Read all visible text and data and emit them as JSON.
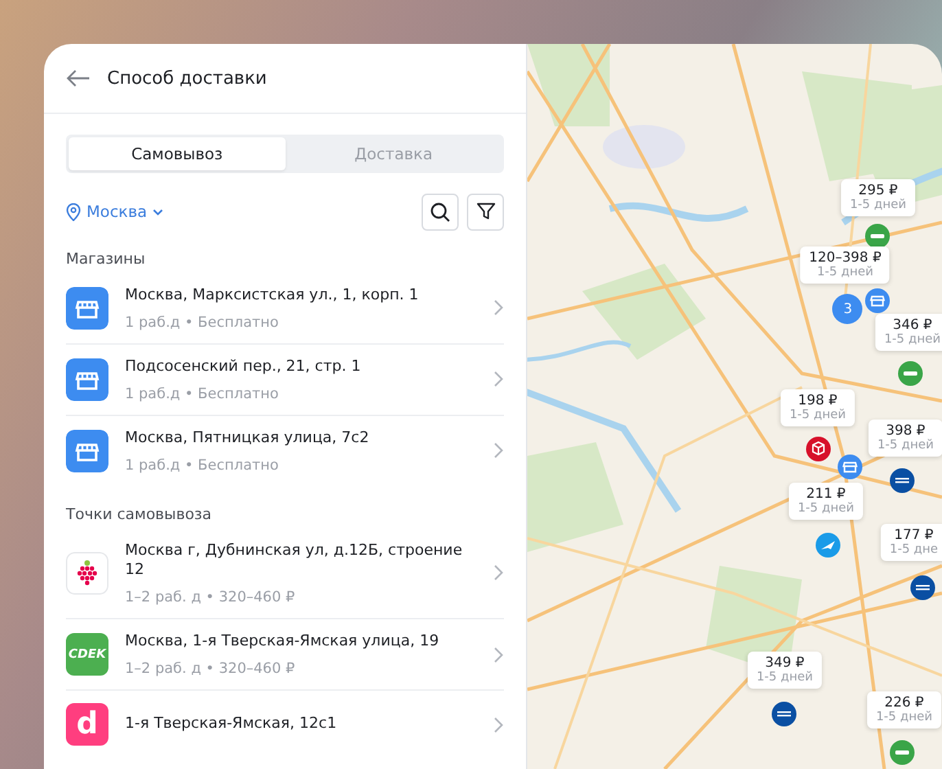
{
  "header": {
    "title": "Способ доставки"
  },
  "tabs": [
    {
      "label": "Самовывоз",
      "selected": true
    },
    {
      "label": "Доставка",
      "selected": false
    }
  ],
  "city": "Москва",
  "sections": [
    {
      "title": "Магазины",
      "items": [
        {
          "kind": "store",
          "address": "Москва, Марксистская ул., 1, корп. 1",
          "details": "1 раб.д • Бесплатно"
        },
        {
          "kind": "store",
          "address": "Подсосенский пер., 21, стр. 1",
          "details": "1 раб.д • Бесплатно"
        },
        {
          "kind": "store",
          "address": "Москва, Пятницкая улица, 7с2",
          "details": "1 раб.д • Бесплатно"
        }
      ]
    },
    {
      "title": "Точки самовывоза",
      "items": [
        {
          "kind": "berry",
          "address": "Москва г, Дубнинская ул, д.12Б, строение 12",
          "details": "1–2 раб. д • 320–460 ₽"
        },
        {
          "kind": "cdek",
          "logo_text": "CDEK",
          "address": "Москва, 1-я Тверская-Ямская улица, 19",
          "details": "1–2 раб. д • 320–460 ₽"
        },
        {
          "kind": "pink",
          "logo_text": "d",
          "address": "1-я Тверская-Ямская, 12с1"
        }
      ]
    }
  ],
  "map": {
    "price_pins": [
      {
        "price": "295 ₽",
        "days": "1-5 дней"
      },
      {
        "price": "120–398 ₽",
        "days": "1-5 дней"
      },
      {
        "price": "346 ₽",
        "days": "1-5 дней"
      },
      {
        "price": "198 ₽",
        "days": "1-5 дней"
      },
      {
        "price": "398 ₽",
        "days": "1-5 дней"
      },
      {
        "price": "211 ₽",
        "days": "1-5 дней"
      },
      {
        "price": "177 ₽",
        "days": "1-5 дне"
      },
      {
        "price": "349 ₽",
        "days": "1-5 дней"
      },
      {
        "price": "226 ₽",
        "days": "1-5 дней"
      }
    ],
    "cluster": "3",
    "markers": [
      {
        "kind": "green"
      },
      {
        "kind": "store"
      },
      {
        "kind": "green"
      },
      {
        "kind": "box"
      },
      {
        "kind": "store"
      },
      {
        "kind": "post"
      },
      {
        "kind": "plane"
      },
      {
        "kind": "post"
      },
      {
        "kind": "post"
      },
      {
        "kind": "green"
      }
    ]
  }
}
